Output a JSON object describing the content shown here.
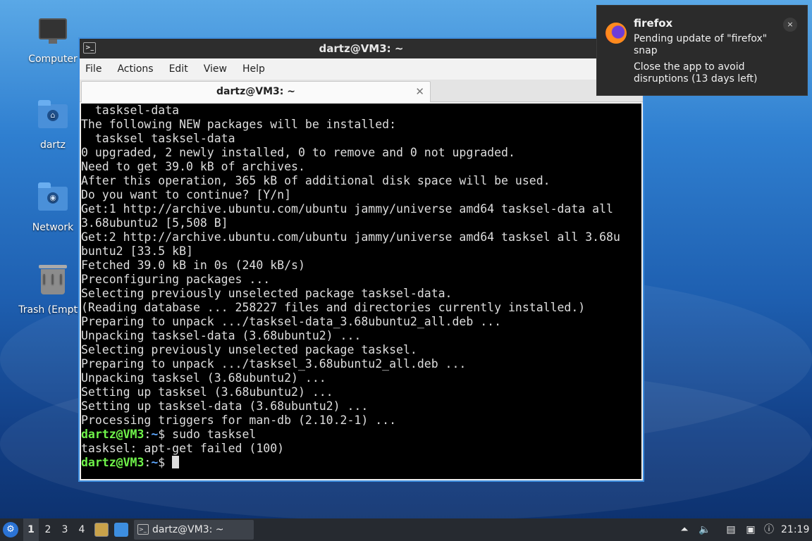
{
  "desktop": {
    "icons": [
      {
        "label": "Computer",
        "icon": "computer-icon"
      },
      {
        "label": "dartz",
        "icon": "home-folder-icon"
      },
      {
        "label": "Network",
        "icon": "network-folder-icon"
      },
      {
        "label": "Trash (Empty)",
        "icon": "trash-icon"
      }
    ]
  },
  "window": {
    "title": "dartz@VM3: ~",
    "menu": [
      "File",
      "Actions",
      "Edit",
      "View",
      "Help"
    ],
    "tab_label": "dartz@VM3: ~",
    "terminal": {
      "lines": [
        "  tasksel-data",
        "The following NEW packages will be installed:",
        "  tasksel tasksel-data",
        "0 upgraded, 2 newly installed, 0 to remove and 0 not upgraded.",
        "Need to get 39.0 kB of archives.",
        "After this operation, 365 kB of additional disk space will be used.",
        "Do you want to continue? [Y/n]",
        "Get:1 http://archive.ubuntu.com/ubuntu jammy/universe amd64 tasksel-data all",
        "3.68ubuntu2 [5,508 B]",
        "Get:2 http://archive.ubuntu.com/ubuntu jammy/universe amd64 tasksel all 3.68u",
        "buntu2 [33.5 kB]",
        "Fetched 39.0 kB in 0s (240 kB/s)",
        "Preconfiguring packages ...",
        "Selecting previously unselected package tasksel-data.",
        "(Reading database ... 258227 files and directories currently installed.)",
        "Preparing to unpack .../tasksel-data_3.68ubuntu2_all.deb ...",
        "Unpacking tasksel-data (3.68ubuntu2) ...",
        "Selecting previously unselected package tasksel.",
        "Preparing to unpack .../tasksel_3.68ubuntu2_all.deb ...",
        "Unpacking tasksel (3.68ubuntu2) ...",
        "Setting up tasksel (3.68ubuntu2) ...",
        "Setting up tasksel-data (3.68ubuntu2) ...",
        "Processing triggers for man-db (2.10.2-1) ..."
      ],
      "prompt_user": "dartz@VM3",
      "prompt_sep": ":",
      "prompt_path": "~",
      "prompt_end": "$ ",
      "command": "sudo tasksel",
      "error_line": "tasksel: apt-get failed (100)"
    }
  },
  "notification": {
    "app": "firefox",
    "message1": "Pending update of \"firefox\" snap",
    "message2": "Close the app to avoid disruptions (13 days left)",
    "close": "×"
  },
  "taskbar": {
    "workspaces": [
      "1",
      "2",
      "3",
      "4"
    ],
    "task_label": "dartz@VM3: ~",
    "clock": "21:19"
  }
}
